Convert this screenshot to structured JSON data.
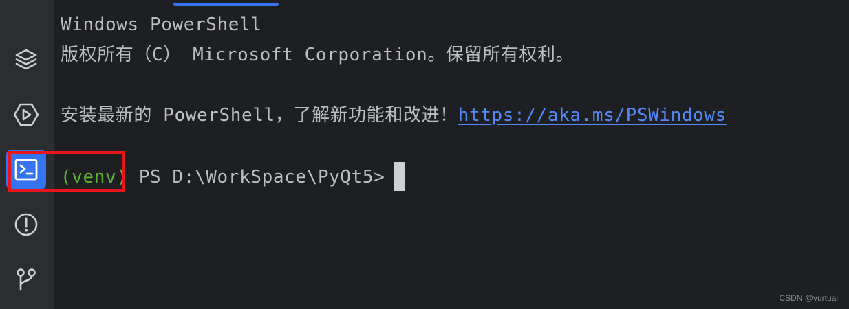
{
  "sidebar": {
    "tools": [
      {
        "icon": "layers-icon",
        "active": false
      },
      {
        "icon": "run-services-icon",
        "active": false
      },
      {
        "icon": "terminal-icon",
        "active": true
      },
      {
        "icon": "problems-icon",
        "active": false
      },
      {
        "icon": "git-branch-icon",
        "active": false
      }
    ]
  },
  "terminal": {
    "line1": "Windows PowerShell",
    "line2": "版权所有（C） Microsoft Corporation。保留所有权利。",
    "line3_text": "安装最新的 PowerShell，了解新功能和改进！",
    "line3_link": "https://aka.ms/PSWindows",
    "prompt_venv": "(venv)",
    "prompt_path": " PS D:\\WorkSpace\\PyQt5>"
  },
  "colors": {
    "accent": "#3574f0",
    "venv": "#5fb236",
    "link": "#548af7",
    "highlight": "#e8161b"
  },
  "watermark": "CSDN @vurtual"
}
